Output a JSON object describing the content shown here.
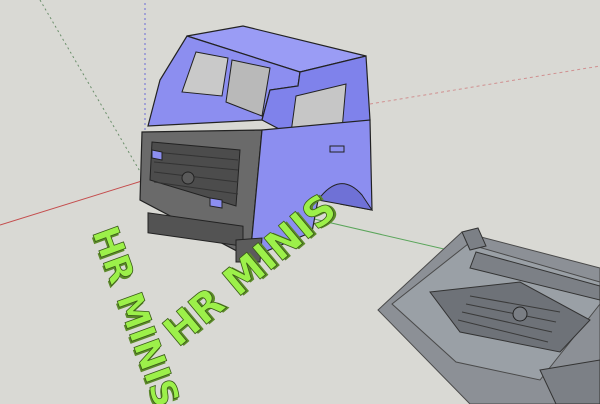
{
  "scene": {
    "background": "#d9d9d4",
    "axis_colors": {
      "red": "#c44d4d",
      "green": "#5aa55a",
      "blue": "#6b6bd6"
    },
    "cab_color": "#8c8ef0",
    "cab_shade_color": "#6f71d6",
    "grille_color": "#5c5c5c",
    "text_color": "#9cf04a"
  },
  "texts": {
    "vertical_label": "HR MINIS",
    "horizontal_label": "HR MINIS"
  },
  "panel": {
    "color": "#8c9096",
    "edge_color": "#4a4a4a"
  }
}
